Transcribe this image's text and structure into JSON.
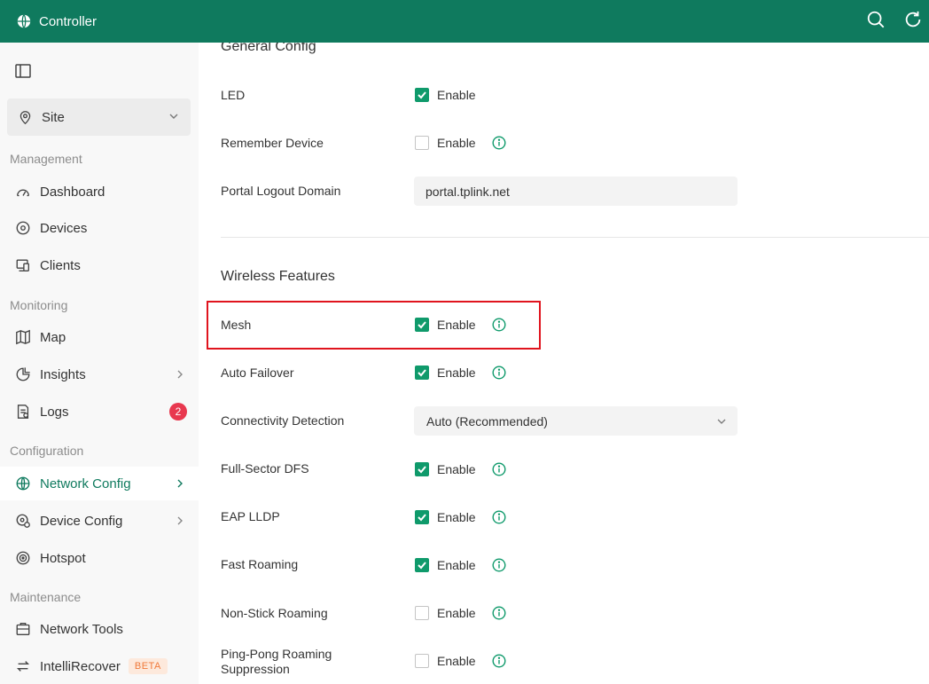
{
  "app": {
    "title": "Controller"
  },
  "sidebar": {
    "site": {
      "label": "Site"
    },
    "sections": {
      "management": "Management",
      "monitoring": "Monitoring",
      "configuration": "Configuration",
      "maintenance": "Maintenance"
    },
    "items": [
      {
        "label": "Dashboard",
        "icon": "dashboard-icon"
      },
      {
        "label": "Devices",
        "icon": "devices-icon"
      },
      {
        "label": "Clients",
        "icon": "clients-icon"
      },
      {
        "label": "Map",
        "icon": "map-icon"
      },
      {
        "label": "Insights",
        "icon": "insights-icon"
      },
      {
        "label": "Logs",
        "icon": "logs-icon",
        "badge": "2"
      },
      {
        "label": "Network Config",
        "icon": "globe-icon",
        "active": true
      },
      {
        "label": "Device Config",
        "icon": "device-config-icon"
      },
      {
        "label": "Hotspot",
        "icon": "hotspot-icon"
      },
      {
        "label": "Network Tools",
        "icon": "toolbox-icon"
      },
      {
        "label": "IntelliRecover",
        "icon": "recover-icon",
        "tag": "BETA"
      }
    ]
  },
  "general": {
    "heading": "General Config",
    "led": {
      "label": "LED",
      "checkbox": "Enable",
      "checked": true
    },
    "remember_device": {
      "label": "Remember Device",
      "checkbox": "Enable",
      "checked": false
    },
    "portal_logout": {
      "label": "Portal Logout Domain",
      "value": "portal.tplink.net"
    }
  },
  "wireless": {
    "heading": "Wireless Features",
    "mesh": {
      "label": "Mesh",
      "checkbox": "Enable",
      "checked": true
    },
    "auto_failover": {
      "label": "Auto Failover",
      "checkbox": "Enable",
      "checked": true
    },
    "connectivity_detection": {
      "label": "Connectivity Detection",
      "value": "Auto (Recommended)"
    },
    "full_sector_dfs": {
      "label": "Full-Sector DFS",
      "checkbox": "Enable",
      "checked": true
    },
    "eap_lldp": {
      "label": "EAP LLDP",
      "checkbox": "Enable",
      "checked": true
    },
    "fast_roaming": {
      "label": "Fast Roaming",
      "checkbox": "Enable",
      "checked": true
    },
    "non_stick_roaming": {
      "label": "Non-Stick Roaming",
      "checkbox": "Enable",
      "checked": false
    },
    "ping_pong": {
      "label_line1": "Ping-Pong Roaming",
      "label_line2": "Suppression",
      "checkbox": "Enable",
      "checked": false
    }
  },
  "colors": {
    "brand": "#0f7a5e",
    "check": "#0f9a6b",
    "highlight": "#e0141e",
    "badge": "#e8384f"
  }
}
